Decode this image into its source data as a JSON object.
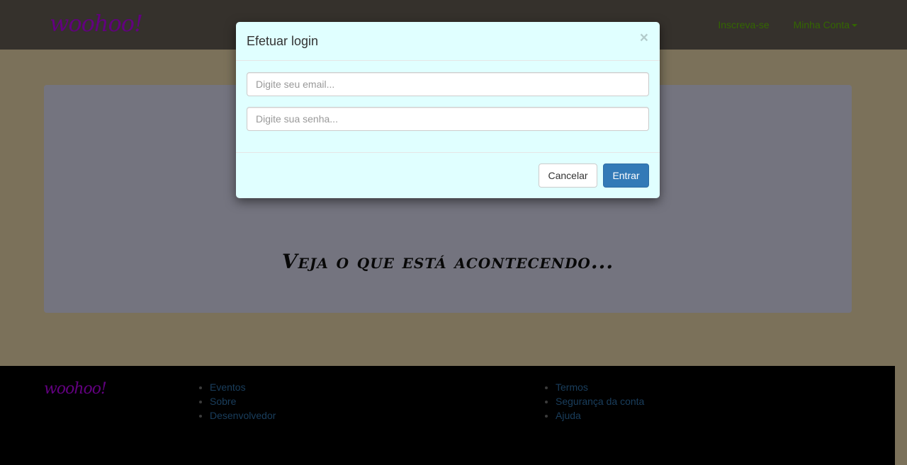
{
  "navbar": {
    "brand": "woohoo!",
    "links": [
      "Inscreva-se",
      "Minha Conta"
    ]
  },
  "jumbotron": {
    "text": "Veja o que está acontecendo..."
  },
  "footer": {
    "brand": "woohoo!",
    "col1": [
      "Eventos",
      "Sobre",
      "Desenvolvedor"
    ],
    "col2": [
      "Termos",
      "Segurança da conta",
      "Ajuda"
    ]
  },
  "modal": {
    "title": "Efetuar login",
    "close_glyph": "×",
    "email_placeholder": "Digite seu email...",
    "password_placeholder": "Digite sua senha...",
    "cancel_label": "Cancelar",
    "submit_label": "Entrar"
  },
  "colors": {
    "brand": "#c400ff",
    "nav_link": "#66cc00",
    "primary": "#337ab7",
    "modal_bg": "#e0ffff"
  }
}
